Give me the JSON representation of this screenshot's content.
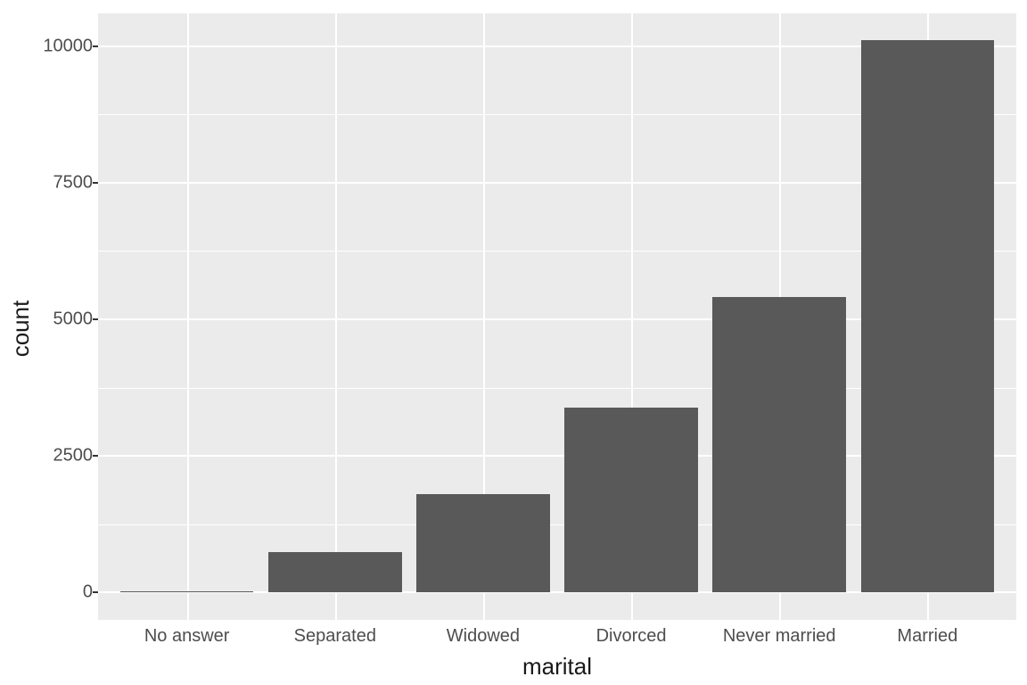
{
  "chart_data": {
    "type": "bar",
    "categories": [
      "No answer",
      "Separated",
      "Widowed",
      "Divorced",
      "Never married",
      "Married"
    ],
    "values": [
      17,
      743,
      1807,
      3383,
      5416,
      10117
    ],
    "title": "",
    "xlabel": "marital",
    "ylabel": "count",
    "ylim": [
      -500,
      10600
    ],
    "yticks": [
      0,
      2500,
      5000,
      7500,
      10000
    ],
    "bar_fill": "#595959",
    "panel_bg": "#ebebeb"
  },
  "yticks": {
    "0": "0",
    "1": "2500",
    "2": "5000",
    "3": "7500",
    "4": "10000"
  },
  "xticks": {
    "0": "No answer",
    "1": "Separated",
    "2": "Widowed",
    "3": "Divorced",
    "4": "Never married",
    "5": "Married"
  },
  "axis": {
    "x": "marital",
    "y": "count"
  }
}
